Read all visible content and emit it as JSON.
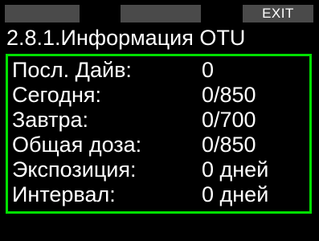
{
  "softkeys": {
    "left": "",
    "middle": "",
    "right": "EXIT"
  },
  "title": "2.8.1.Информация OTU",
  "rows": [
    {
      "label": "Посл. Дайв:",
      "value": "0"
    },
    {
      "label": "Сегодня:",
      "value": "0/850"
    },
    {
      "label": "Завтра:",
      "value": "0/700"
    },
    {
      "label": "Общая доза:",
      "value": "0/850"
    },
    {
      "label": "Экспозиция:",
      "value": "0 дней"
    },
    {
      "label": "Интервал:",
      "value": "0 дней"
    }
  ],
  "colors": {
    "background": "#000000",
    "text": "#ffffff",
    "softkey": "#4a4a4a",
    "panel_border": "#00e000"
  }
}
